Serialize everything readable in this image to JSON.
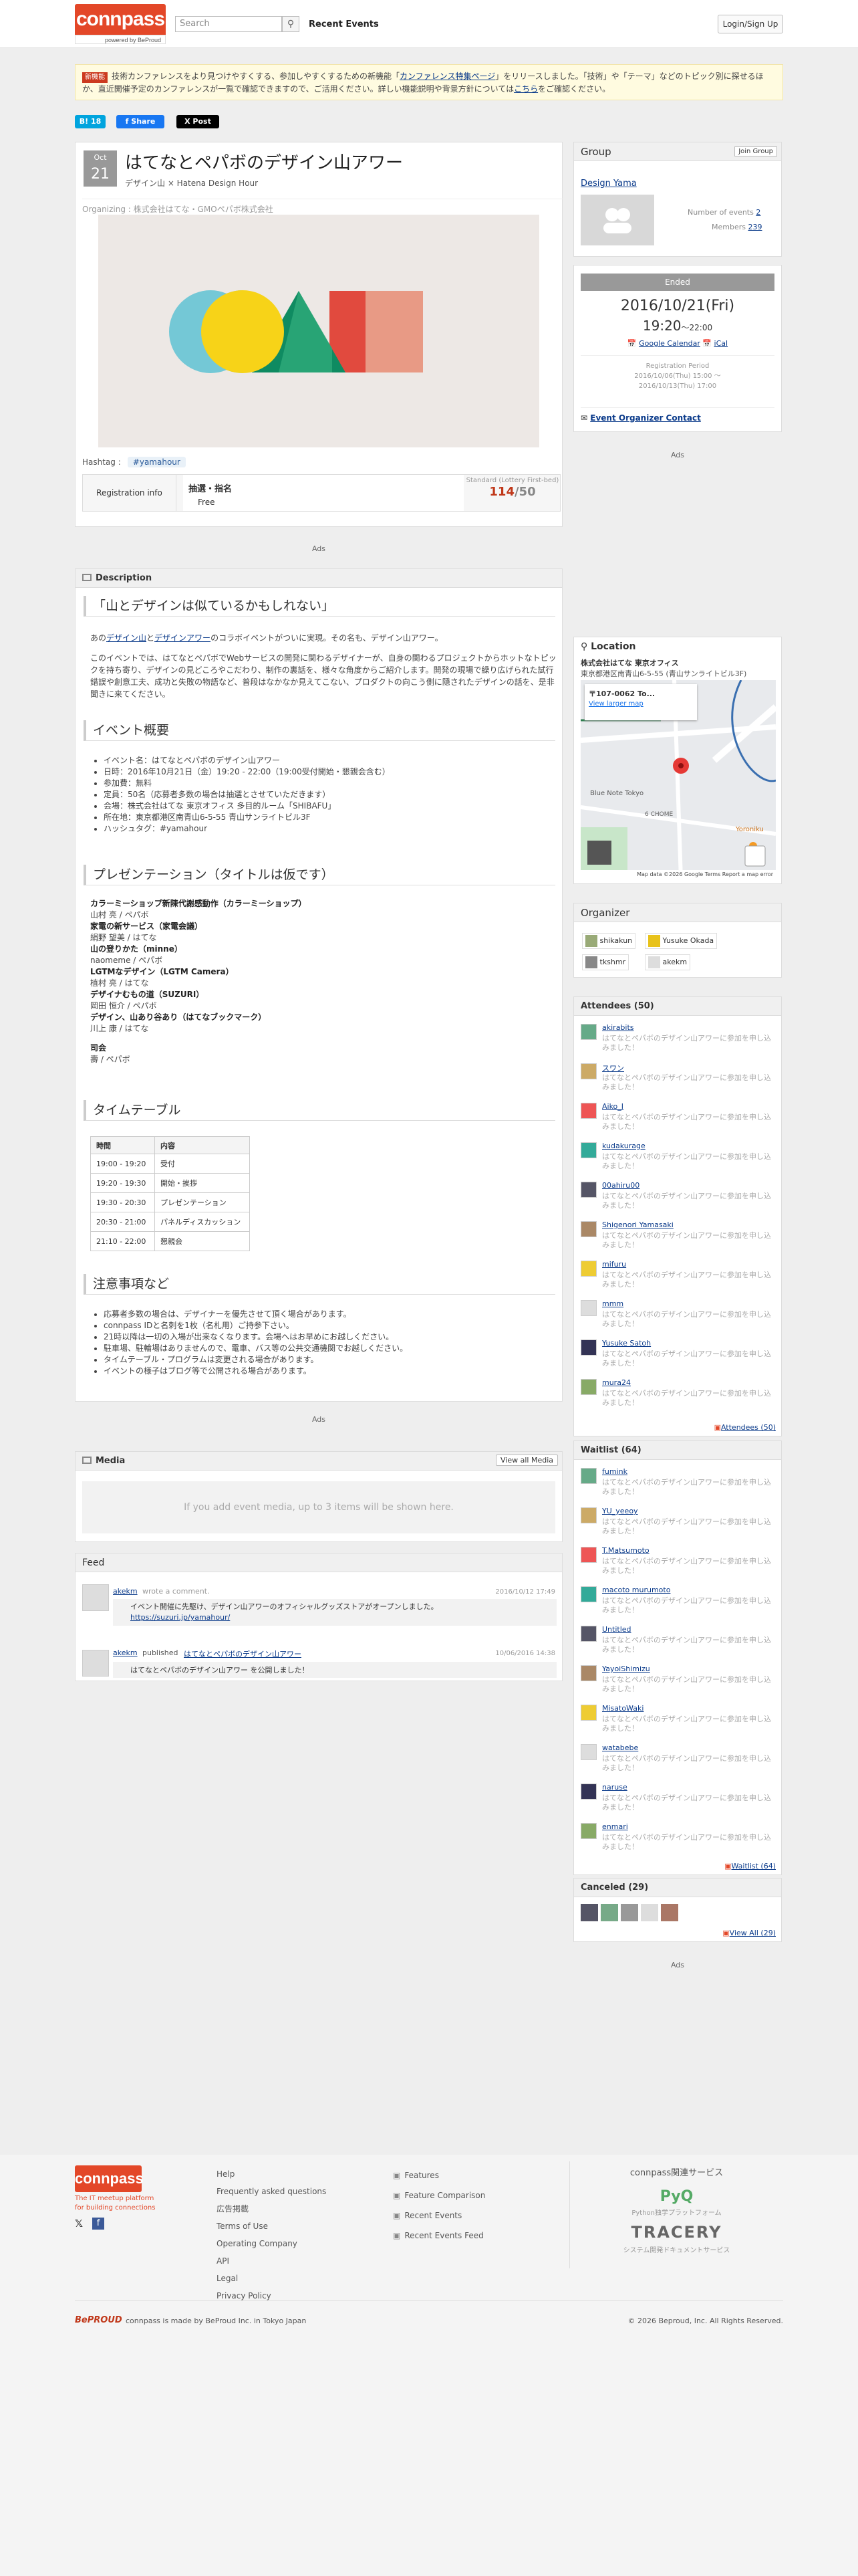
{
  "header": {
    "logo": "connpass",
    "logo_sub": "powered by BeProud",
    "search_placeholder": "Search",
    "recent": "Recent Events",
    "login": "Login/Sign Up"
  },
  "notice": {
    "badge": "新機能",
    "text_pre": "技術カンファレンスをより見つけやすくする、参加しやすくするための新機能「",
    "link": "カンファレンス特集ページ",
    "text_mid": "」をリリースしました。「技術」や「テーマ」などのトピック別に探せるほか、直近開催予定のカンファレンスが一覧で確認できますので、ご活用ください。詳しい機能説明や背景方針については",
    "link2": "こちら",
    "text_post": "をご確認ください。"
  },
  "share": {
    "hatena": "B! 18",
    "facebook": "f Share",
    "x": "X Post"
  },
  "event": {
    "month": "Oct",
    "day": "21",
    "title": "はてなとペパボのデザイン山アワー",
    "subtitle": "デザイン山 × Hatena Design Hour",
    "organizing": "Organizing : 株式会社はてな・GMOペパボ株式会社",
    "hashtag_label": "Hashtag :",
    "hashtag": "#yamahour",
    "reg_label": "Registration info",
    "reg_type": "抽選・指名",
    "reg_fee": "Free",
    "reg_note": "Standard (Lottery First-bed)",
    "reg_count": "114",
    "reg_cap": "/50"
  },
  "ads": "Ads",
  "description": {
    "header": "Description",
    "h1": "「山とデザインは似ているかもしれない」",
    "p1_pre": "あの",
    "p1_link1": "デザイン山",
    "p1_and": "と",
    "p1_link2": "デザインアワー",
    "p1_post": "のコラボイベントがついに実現。その名も、デザイン山アワー。",
    "p2": "このイベントでは、はてなとペパボでWebサービスの開発に関わるデザイナーが、自身の関わるプロジェクトからホットなトピックを持ち寄り、デザインの見どころやこだわり、制作の裏話を、様々な角度からご紹介します。開発の現場で繰り広げられた試行錯誤や創意工夫、成功と失敗の物語など、普段はなかなか見えてこない、プロダクトの向こう側に隠されたデザインの話を、是非聞きに来てください。",
    "h2": "イベント概要",
    "overview": [
      "イベント名：はてなとペパボのデザイン山アワー",
      "日時：2016年10月21日（金）19:20 - 22:00（19:00受付開始・懇親会含む）",
      "参加費：無料",
      "定員：50名（応募者多数の場合は抽選とさせていただきます）",
      "会場：株式会社はてな 東京オフィス 多目的ルーム「SHIBAFU」",
      "所在地：東京都港区南青山6-5-55 青山サンライトビル3F",
      "ハッシュタグ：#yamahour"
    ],
    "h3": "プレゼンテーション（タイトルは仮です）",
    "talks": [
      {
        "t": "カラーミーショップ新陳代謝感動作（カラーミーショップ）",
        "s": "山村 亮 / ペパボ"
      },
      {
        "t": "家電の新サービス（家電会議）",
        "s": "絹野 望美 / はてな"
      },
      {
        "t": "山の登りかた（minne）",
        "s": "naomeme / ペパボ"
      },
      {
        "t": "LGTMなデザイン（LGTM Camera）",
        "s": "植村 亮 / はてな"
      },
      {
        "t": "デザイナむもの道（SUZURI）",
        "s": "岡田 恒介 / ペパボ"
      },
      {
        "t": "デザイン、山あり谷あり（はてなブックマーク）",
        "s": "川上 康 / はてな"
      },
      {
        "t": "司会",
        "s": "壽 / ペパボ"
      }
    ],
    "h4": "タイムテーブル",
    "tt_head": [
      "時間",
      "内容"
    ],
    "tt_rows": [
      [
        "19:00 - 19:20",
        "受付"
      ],
      [
        "19:20 - 19:30",
        "開始・挨拶"
      ],
      [
        "19:30 - 20:30",
        "プレゼンテーション"
      ],
      [
        "20:30 - 21:00",
        "パネルディスカッション"
      ],
      [
        "21:10 - 22:00",
        "懇親会"
      ]
    ],
    "h5": "注意事項など",
    "notes": [
      "応募者多数の場合は、デザイナーを優先させて頂く場合があります。",
      "connpass IDと名刺を1枚（名札用）ご持参下さい。",
      "21時以降は一切の入場が出来なくなります。会場へはお早めにお越しください。",
      "駐車場、駐輪場はありませんので、電車、バス等の公共交通機関でお越しください。",
      "タイムテーブル・プログラムは変更される場合があります。",
      "イベントの様子はブログ等で公開される場合があります。"
    ]
  },
  "media": {
    "header": "Media",
    "view_all": "View all Media",
    "empty": "If you add event media, up to 3 items will be shown here."
  },
  "feed": {
    "header": "Feed",
    "items": [
      {
        "user": "akekm",
        "action": "wrote a comment.",
        "date": "2016/10/12 17:49",
        "body": "イベント開催に先駆け、デザイン山アワーのオフィシャルグッズストアがオープンしました。",
        "link": "https://suzuri.jp/yamahour/"
      },
      {
        "user": "akekm",
        "action": "published",
        "link": "はてなとペパボのデザイン山アワー",
        "date": "10/06/2016 14:38",
        "body": "はてなとペパボのデザイン山アワー を公開しました！"
      }
    ]
  },
  "group": {
    "header": "Group",
    "join": "Join Group",
    "name": "Design Yama",
    "events_label": "Number of events",
    "events": "2",
    "members_label": "Members",
    "members": "239"
  },
  "status": {
    "ended": "Ended",
    "date": "2016/10/21(Fri)",
    "time": "19:20",
    "time_end": "～22:00",
    "gcal": "Google Calendar",
    "ical": "iCal",
    "period_label": "Registration Period",
    "period1": "2016/10/06(Thu) 15:00 ～",
    "period2": "2016/10/13(Thu) 17:00",
    "contact": "Event Organizer Contact"
  },
  "location": {
    "header": "Location",
    "venue": "株式会社はてな 東京オフィス",
    "address": "東京都港区南青山6-5-55 (青山サンライトビル3F)",
    "map_addr": "〒107-0062 To...",
    "map_link": "View larger map",
    "map_label1": "Blue Note Tokyo",
    "map_label2": "Yoroniku",
    "map_label3": "6 CHOME",
    "map_footer": "Map data ©2026 Google   Terms   Report a map error"
  },
  "organizer": {
    "header": "Organizer",
    "items": [
      "shikakun",
      "Yusuke Okada",
      "tkshmr",
      "akekm"
    ]
  },
  "attendees": {
    "header": "Attendees (50)",
    "comment": "はてなとペパボのデザイン山アワーに参加を申し込みました！",
    "items": [
      "akirabits",
      "スワン",
      "Aiko_I",
      "kudakurage",
      "00ahiru00",
      "Shigenori Yamasaki",
      "mifuru",
      "mmm",
      "Yusuke Satoh",
      "mura24"
    ],
    "more": "Attendees (50)"
  },
  "waitlist": {
    "header": "Waitlist (64)",
    "items": [
      "fumink",
      "YU_yeeoy",
      "T.Matsumoto",
      "macoto murumoto",
      "Untitled",
      "YayoiShimizu",
      "MisatoWaki",
      "watabebe",
      "naruse",
      "enmari"
    ],
    "more": "Waitlist (64)"
  },
  "canceled": {
    "header": "Canceled (29)",
    "more": "View All (29)"
  },
  "footer": {
    "logo": "connpass",
    "tagline1": "The IT meetup platform",
    "tagline2": "for building connections",
    "col1": [
      "Help",
      "Frequently asked questions",
      "広告掲載",
      "Terms of Use",
      "Operating Company",
      "API",
      "Legal",
      "Privacy Policy"
    ],
    "col2": [
      "Features",
      "Feature Comparison",
      "Recent Events",
      "Recent Events Feed"
    ],
    "related": "connpass関連サービス",
    "pyq": "PyQ",
    "pyq_sub": "Python独学プラットフォーム",
    "tracery": "TRACERY",
    "tracery_sub": "システム開発ドキュメントサービス",
    "made": "connpass is made by BeProud Inc. in Tokyo Japan",
    "beproud": "BePROUD",
    "copy": "© 2026 Beproud, Inc. All Rights Reserved."
  },
  "colors": {
    "brand": "#e34728",
    "accent_red": "#c0381a",
    "link": "#0a3a8a"
  }
}
